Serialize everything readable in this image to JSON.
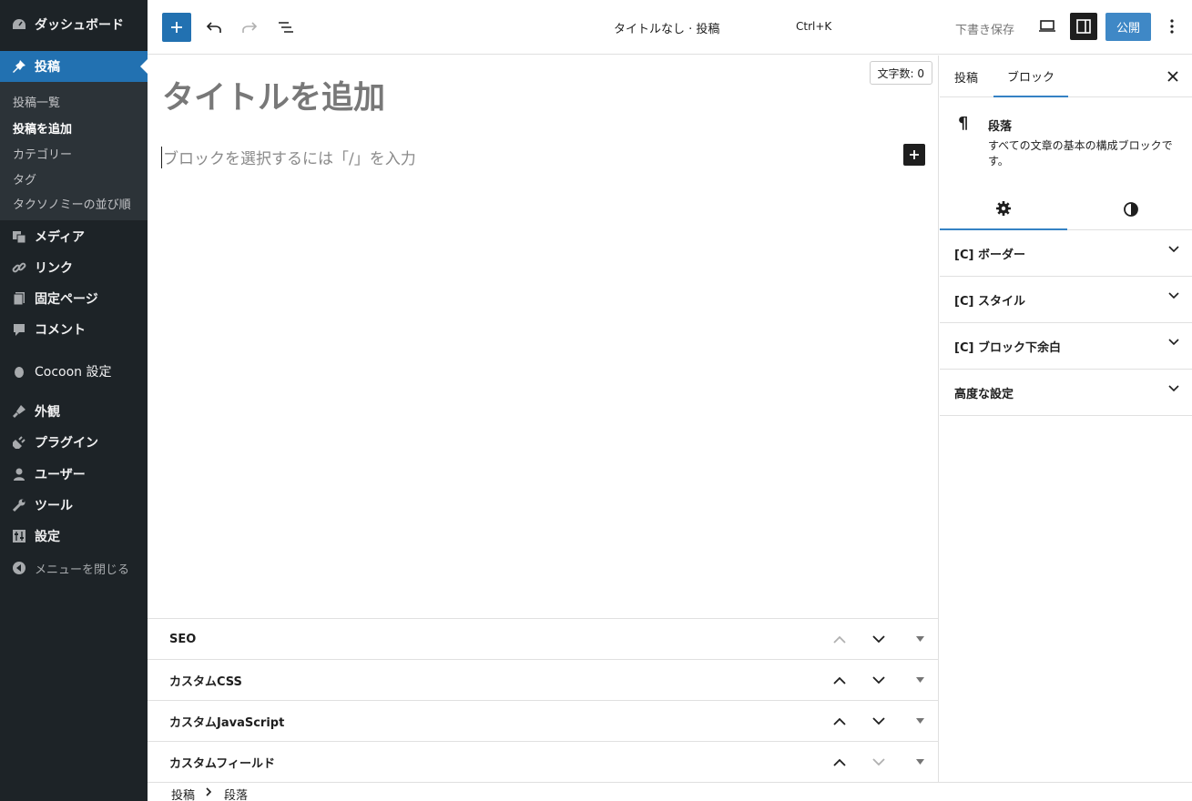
{
  "admin_menu": {
    "items": [
      {
        "label": "ダッシュボード",
        "icon": "dashboard-icon"
      },
      {
        "label": "投稿",
        "icon": "pin-icon"
      },
      {
        "label": "メディア",
        "icon": "media-icon"
      },
      {
        "label": "リンク",
        "icon": "link-icon"
      },
      {
        "label": "固定ページ",
        "icon": "pages-icon"
      },
      {
        "label": "コメント",
        "icon": "comment-icon"
      },
      {
        "label": "Cocoon 設定",
        "icon": "cocoon-icon"
      },
      {
        "label": "外観",
        "icon": "appearance-icon"
      },
      {
        "label": "プラグイン",
        "icon": "plugin-icon"
      },
      {
        "label": "ユーザー",
        "icon": "user-icon"
      },
      {
        "label": "ツール",
        "icon": "tools-icon"
      },
      {
        "label": "設定",
        "icon": "settings-icon"
      },
      {
        "label": "メニューを閉じる",
        "icon": "collapse-icon"
      }
    ],
    "submenu": [
      "投稿一覧",
      "投稿を追加",
      "カテゴリー",
      "タグ",
      "タクソノミーの並び順"
    ]
  },
  "toolbar": {
    "document_title": "タイトルなし · 投稿",
    "command_shortcut": "Ctrl+K",
    "save_draft_label": "下書き保存",
    "publish_label": "公開"
  },
  "editor": {
    "word_count": "文字数: 0",
    "title_placeholder": "タイトルを追加",
    "block_placeholder": "ブロックを選択するには「/」を入力"
  },
  "metaboxes": [
    {
      "title": "SEO"
    },
    {
      "title": "カスタムCSS"
    },
    {
      "title": "カスタムJavaScript"
    },
    {
      "title": "カスタムフィールド"
    }
  ],
  "breadcrumb": [
    "投稿",
    "段落"
  ],
  "sidebar": {
    "tabs": [
      "投稿",
      "ブロック"
    ],
    "block_name": "段落",
    "block_description": "すべての文章の基本の構成ブロックです。",
    "panels": [
      "[C] ボーダー",
      "[C] スタイル",
      "[C] ブロック下余白",
      "高度な設定"
    ]
  },
  "colors": {
    "admin_bg": "#1d2327",
    "accent": "#2271b1",
    "publish": "#3582c4"
  }
}
